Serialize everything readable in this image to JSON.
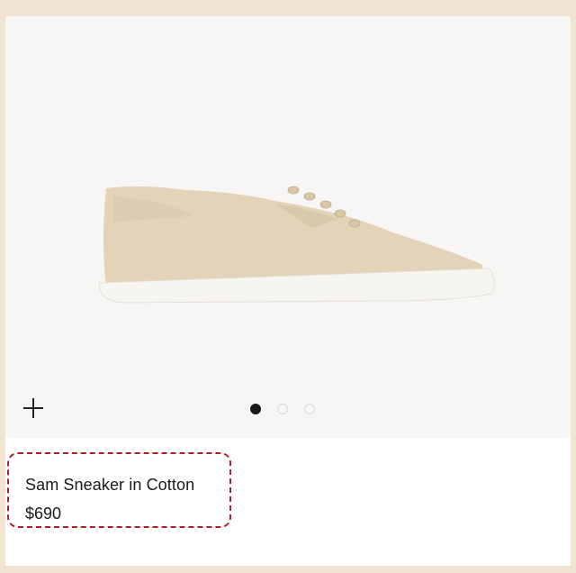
{
  "product": {
    "name": "Sam Sneaker in Cotton",
    "price": "$690",
    "image_alt": "Beige cotton lace-up sneaker with white sole"
  },
  "gallery": {
    "slide_count": 3,
    "active_slide": 1,
    "zoom_icon": "plus-icon"
  },
  "colors": {
    "page_background": "#f1e4d2",
    "image_background": "#f7f6f4",
    "highlight_border": "#b21e24",
    "shoe_upper": "#e2d3b9",
    "sole": "#f7f5ef"
  }
}
